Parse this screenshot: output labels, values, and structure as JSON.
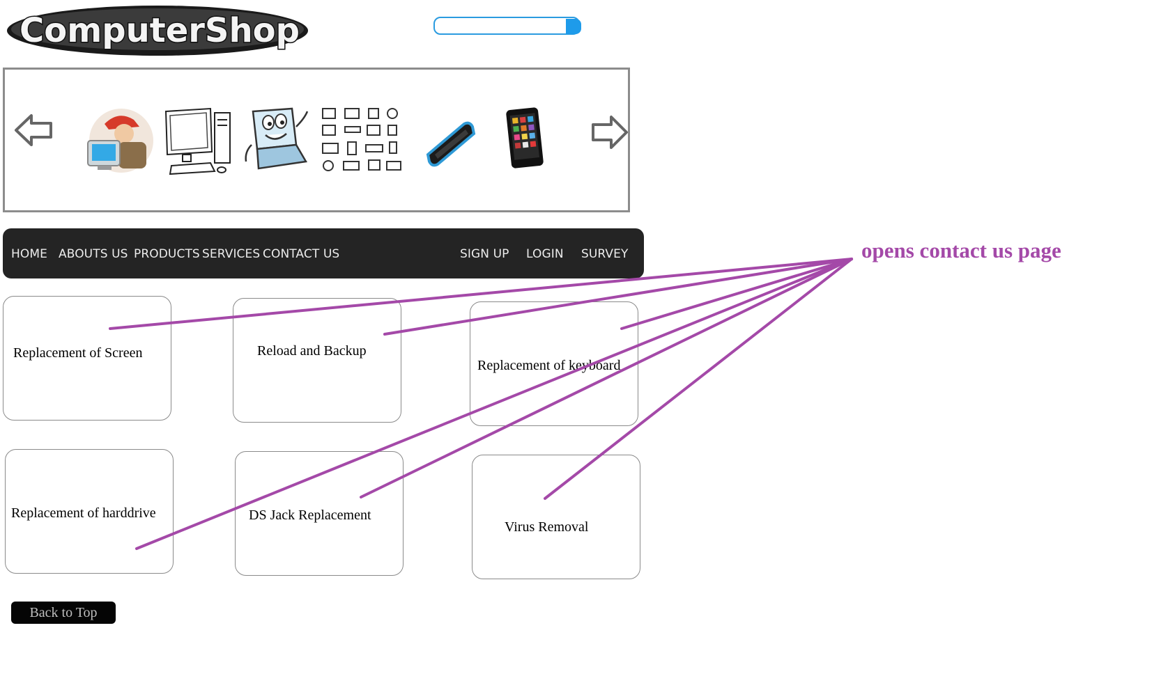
{
  "header": {
    "logo_text": "ComputerShop",
    "search": {
      "placeholder": ""
    }
  },
  "carousel": {
    "prev_icon": "arrow-left-icon",
    "next_icon": "arrow-right-icon",
    "thumbnails": [
      "technician-icon",
      "desktop-computer-icon",
      "laptop-mascot-icon",
      "hardware-parts-icon",
      "mobile-phone-icon",
      "tablet-icon"
    ]
  },
  "nav": {
    "left": [
      "HOME",
      "ABOUTS US",
      "PRODUCTS",
      "SERVICES",
      "CONTACT US"
    ],
    "right": [
      "SIGN UP",
      "LOGIN",
      "SURVEY"
    ]
  },
  "services": [
    "Replacement  of Screen",
    "Reload and Backup",
    "Replacement of keyboard",
    "Replacement of harddrive",
    "DS Jack Replacement",
    "Virus Removal"
  ],
  "back_to_top": "Back to Top",
  "annotation": {
    "text": "opens contact us page",
    "color": "#a449a8"
  },
  "colors": {
    "nav_bg": "#242424",
    "search_accent": "#1e9bea",
    "annotation": "#a449a8"
  }
}
